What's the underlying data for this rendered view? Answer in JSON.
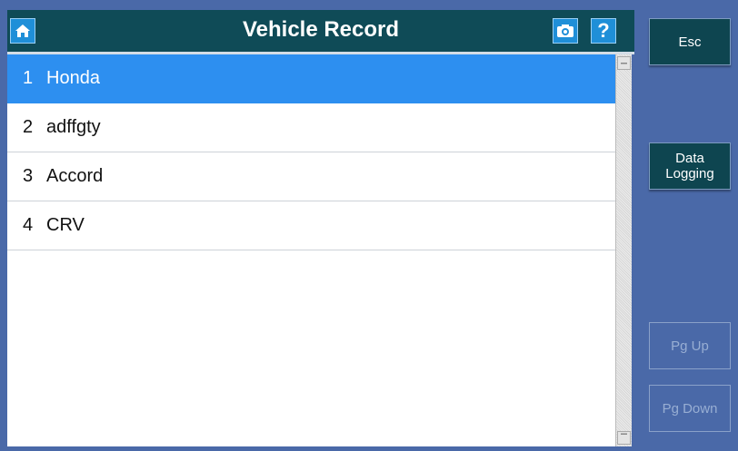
{
  "header": {
    "title": "Vehicle Record",
    "home_icon": "home-icon",
    "camera_icon": "camera-icon",
    "help_icon": "help-icon",
    "help_glyph": "?"
  },
  "list": {
    "items": [
      {
        "num": "1",
        "label": "Honda",
        "selected": true
      },
      {
        "num": "2",
        "label": "adffgty",
        "selected": false
      },
      {
        "num": "3",
        "label": "Accord",
        "selected": false
      },
      {
        "num": "4",
        "label": "CRV",
        "selected": false
      }
    ]
  },
  "sidebar": {
    "esc_label": "Esc",
    "data_logging_line1": "Data",
    "data_logging_line2": "Logging",
    "pg_up_label": "Pg Up",
    "pg_down_label": "Pg Down"
  },
  "colors": {
    "header_bg": "#0f4b57",
    "selected_row": "#2d8ff0",
    "panel_bg": "#4a69a8",
    "button_bg": "#0e4550"
  }
}
